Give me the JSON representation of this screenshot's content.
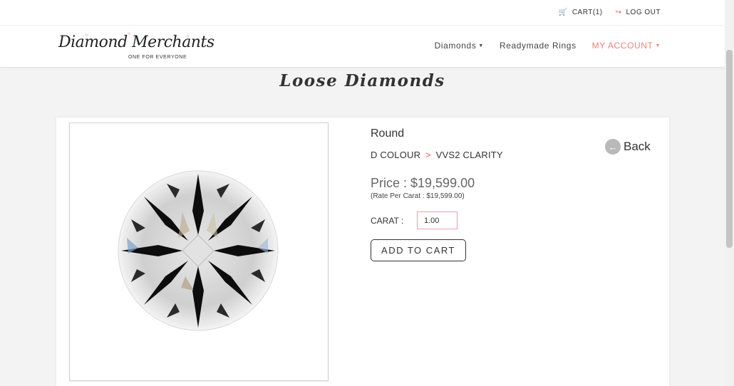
{
  "topbar": {
    "cart_label": "CART(1)",
    "logout_label": "LOG OUT",
    "cart_icon": "cart-icon",
    "logout_icon": "logout-icon"
  },
  "brand": {
    "name": "Diamond Merchants",
    "tagline": "ONE FOR EVERYONE"
  },
  "nav": {
    "diamonds": "Diamonds",
    "rings": "Readymade Rings",
    "account": "MY ACCOUNT"
  },
  "page": {
    "title": "Loose Diamonds"
  },
  "product": {
    "shape": "Round",
    "colour": "D COLOUR",
    "separator": ">",
    "clarity": "VVS2 CLARITY",
    "price": "Price : $19,599.00",
    "rate": "(Rate Per Carat : $19,599.00)",
    "carat_label": "CARAT :",
    "carat_value": "1.00",
    "add_to_cart": "ADD TO CART",
    "back_label": "Back"
  },
  "colors": {
    "accent": "#e8847a",
    "cart_red": "#e05a5a"
  }
}
